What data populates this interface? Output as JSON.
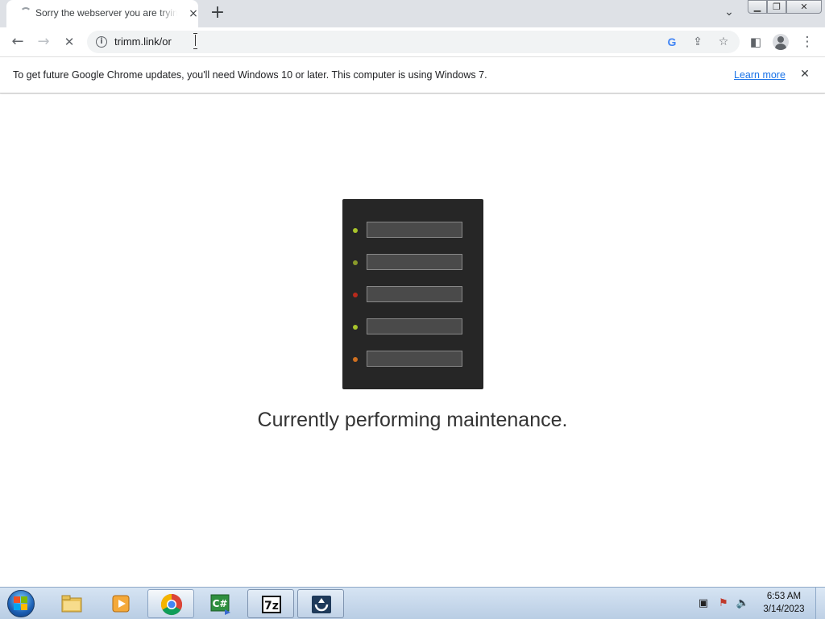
{
  "browser": {
    "tab": {
      "title": "Sorry the webserver you are trying to reach is currently unavailable",
      "close_icon": "×"
    },
    "new_tab_icon": "+",
    "tab_search_icon": "⌄",
    "window_controls": {
      "minimize": "▁",
      "maximize": "❐",
      "close": "✕"
    },
    "toolbar": {
      "back_icon": "←",
      "forward_icon": "→",
      "stop_icon": "✕",
      "url": "trimm.link/or",
      "info_icon": "i"
    },
    "omnibox_icons": {
      "google_lens": "G",
      "share": "⇪",
      "bookmark": "☆"
    },
    "side_panel_icon": "◧",
    "menu_icon": "⋮"
  },
  "infobar": {
    "message": "To get future Google Chrome updates, you'll need Windows 10 or later. This computer is using Windows 7.",
    "learn_more": "Learn more",
    "close_icon": "✕"
  },
  "page": {
    "heading": "Currently performing maintenance.",
    "server_leds": [
      "#a8c42b",
      "#8a9a2a",
      "#b82a1c",
      "#a8c42b",
      "#d07020"
    ]
  },
  "taskbar": {
    "apps": [
      "start-menu",
      "file-explorer",
      "media-player",
      "google-chrome",
      "csharp-editor",
      "7-zip",
      "install-tool"
    ],
    "clock": {
      "time": "6:53 AM",
      "date": "3/14/2023"
    }
  },
  "colors": {
    "tabstrip": "#dee1e6",
    "omnibox": "#f1f3f4",
    "link": "#1a73e8",
    "server_body": "#262626",
    "taskbar": "#c7d8ec"
  }
}
